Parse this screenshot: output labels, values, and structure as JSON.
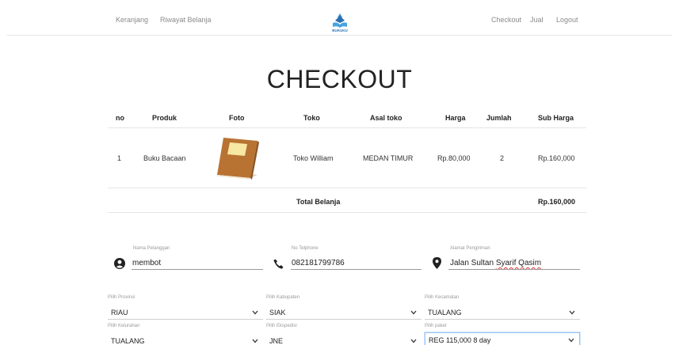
{
  "nav": {
    "keranjang": "Keranjang",
    "riwayat": "Riwayat Belanja",
    "brand": "BUKUKU",
    "checkout": "Checkout",
    "jual": "Jual",
    "logout": "Logout"
  },
  "page_title": "CHECKOUT",
  "table": {
    "headers": [
      "no",
      "Produk",
      "Foto",
      "Toko",
      "Asal toko",
      "Harga",
      "Jumlah",
      "Sub Harga"
    ],
    "rows": [
      {
        "no": "1",
        "produk": "Buku Bacaan",
        "foto_icon": "book-icon",
        "toko": "Toko William",
        "asal": "MEDAN TIMUR",
        "harga": "Rp.80,000",
        "jumlah": "2",
        "sub": "Rp.160,000"
      }
    ],
    "total_label": "Total Belanja",
    "total_value": "Rp.160,000"
  },
  "form": {
    "nama": {
      "label": "Nama Pelanggan",
      "value": "membot",
      "icon": "user-circle-icon"
    },
    "telp": {
      "label": "No Telphone",
      "value": "082181799786",
      "icon": "phone-icon"
    },
    "alamat": {
      "label": "Alamat Pengiriman",
      "value_prefix": "Jalan Sultan ",
      "value_marked": "Syarif Qasim",
      "icon": "location-pin-icon"
    },
    "provinsi": {
      "label": "Pilih Provinsi",
      "value": "RIAU"
    },
    "kabupaten": {
      "label": "Pilih Kabupaten",
      "value": "SIAK"
    },
    "kecamatan": {
      "label": "Pilih Kecamatan",
      "value": "TUALANG"
    },
    "kelurahan": {
      "label": "Pilih Kelurahan",
      "value": "TUALANG"
    },
    "ekspedisi": {
      "label": "Pilih Ekspedisi",
      "value": "JNE"
    },
    "paket": {
      "label": "Pilih paket",
      "value": "REG 115,000 8 day"
    }
  },
  "colors": {
    "accent_focus": "#9ec5f5",
    "book_cover": "#b87333",
    "brand_blue": "#2a6fb0"
  }
}
